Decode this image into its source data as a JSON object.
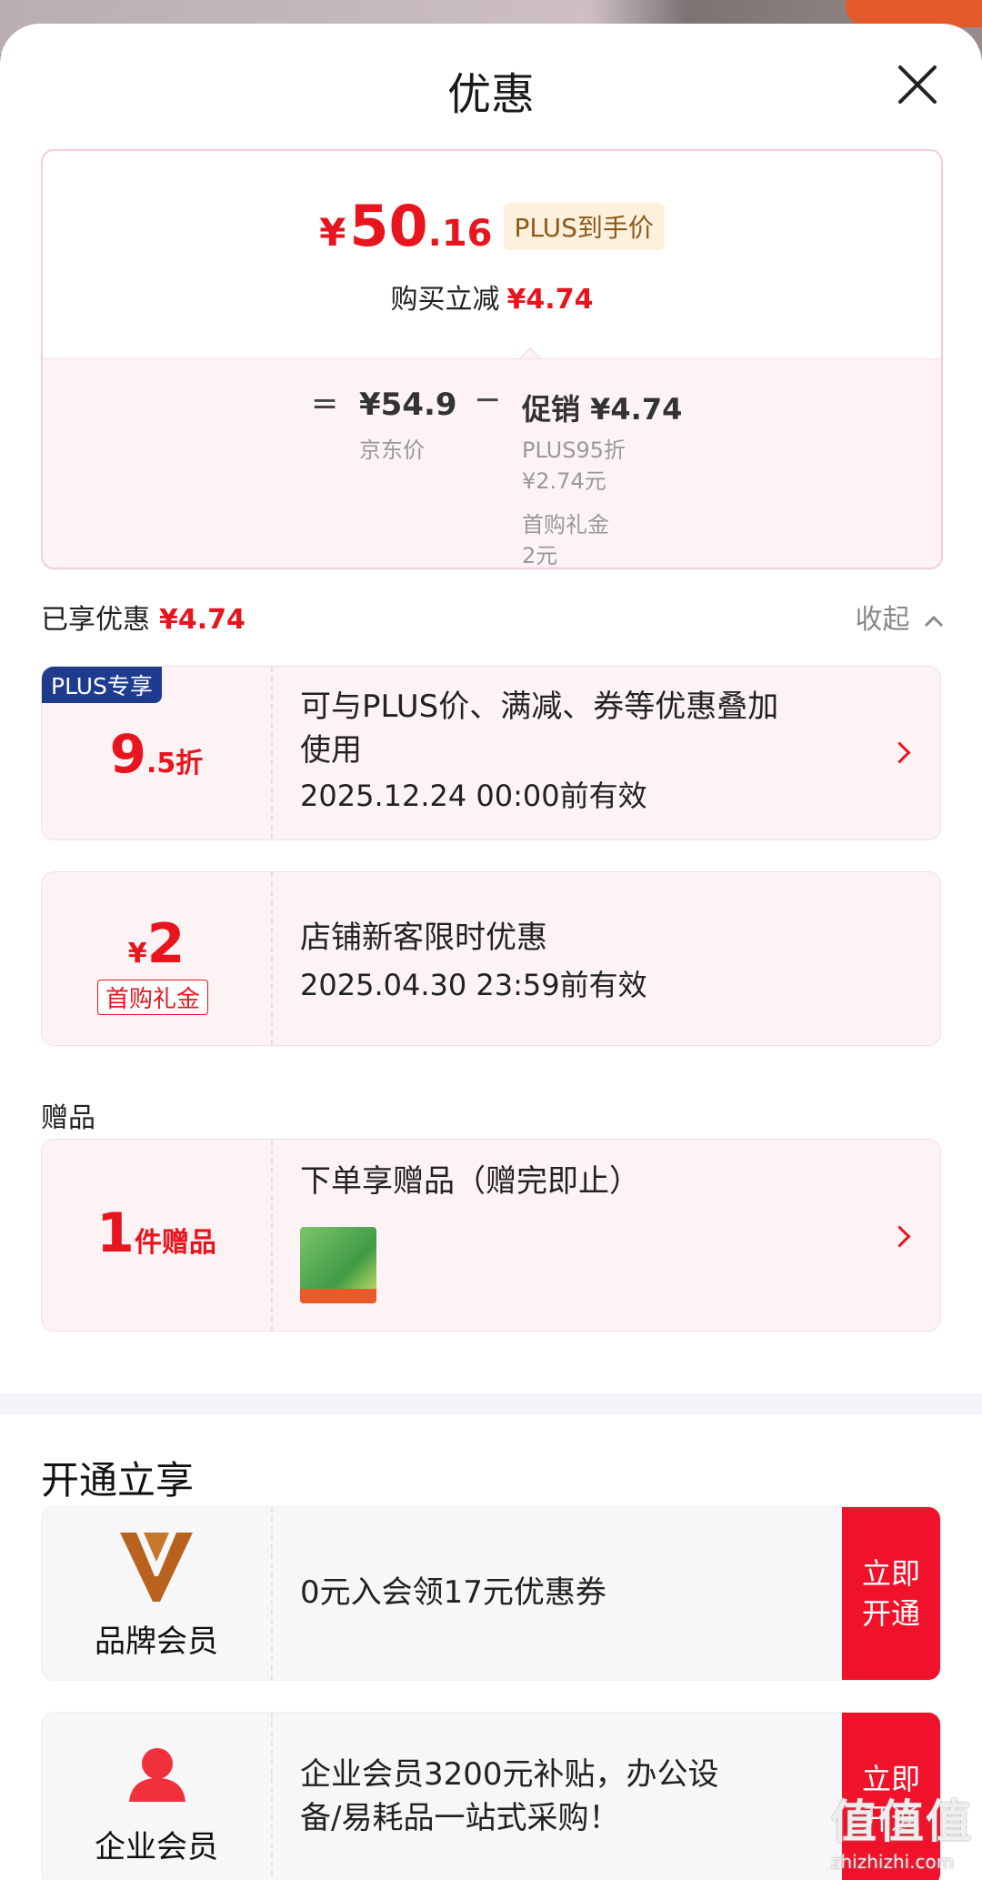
{
  "sheet": {
    "title": "优惠"
  },
  "summary": {
    "currency": "¥",
    "price_int": "50",
    "price_dec": ".16",
    "plus_tag": "PLUS到手价",
    "reduce_label": "购买立减",
    "reduce_value": "¥4.74",
    "equals": "=",
    "jd_price": "¥54.9",
    "jd_label": "京东价",
    "minus": "−",
    "promo_title": "促销 ¥4.74",
    "promo_line1": "PLUS95折",
    "promo_line2": "¥2.74元",
    "promo_line3": "首购礼金",
    "promo_line4": "2元"
  },
  "enjoyed": {
    "label": "已享优惠",
    "value": "¥4.74",
    "collapse": "收起"
  },
  "coupons": [
    {
      "badge": "PLUS专享",
      "big": "9",
      "small": ".5折",
      "line1": "可与PLUS价、满减、券等优惠叠加",
      "line2": "使用",
      "line3": "2025.12.24 00:00前有效"
    },
    {
      "yen": "¥",
      "big": "2",
      "tag": "首购礼金",
      "line1": "店铺新客限时优惠",
      "line2": "2025.04.30 23:59前有效"
    }
  ],
  "gift_section": {
    "title": "赠品",
    "count_big": "1",
    "count_small": "件赠品",
    "text": "下单享赠品（赠完即止）"
  },
  "open_section": {
    "title": "开通立享",
    "items": [
      {
        "label": "品牌会员",
        "desc": "0元入会领17元优惠券",
        "btn1": "立即",
        "btn2": "开通"
      },
      {
        "label": "企业会员",
        "desc1": "企业会员3200元补贴，办公设",
        "desc2": "备/易耗品一站式采购！",
        "btn1": "立即",
        "btn2": "开通"
      }
    ]
  },
  "watermark": {
    "logo": "值值值",
    "url": "zhizhizhi.com"
  },
  "colors": {
    "accent": "#e8141e",
    "plus_badge": "#1f3b8e",
    "open_button": "#f0122a"
  }
}
